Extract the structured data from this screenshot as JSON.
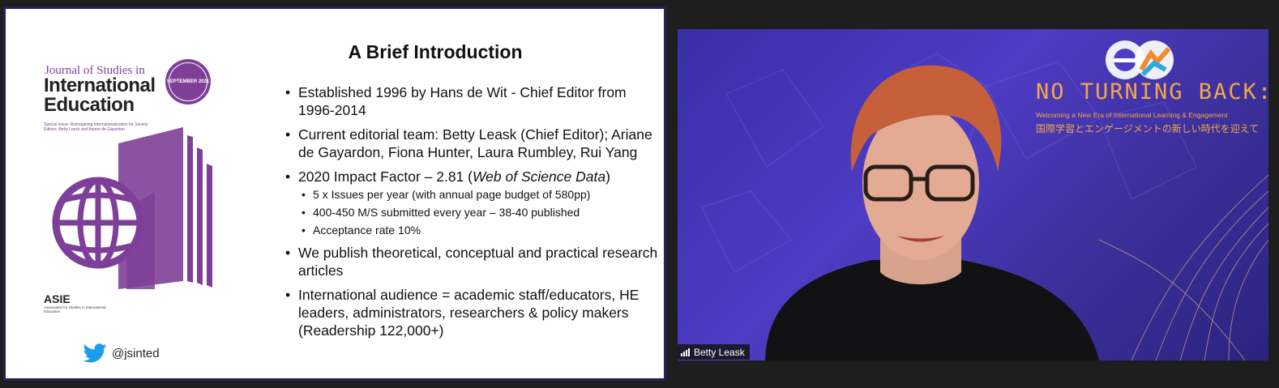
{
  "slide": {
    "title": "A Brief Introduction",
    "cover": {
      "journal_line1": "Journal of Studies in",
      "journal_line2a": "International",
      "journal_line2b": "Education",
      "badge_text": "SEPTEMBER 2021",
      "special_issue": "Special Issue: Reimagining Internationalization for Society Editors: Betty Leask and Ariane de Gayardon",
      "publisher": "ASIE",
      "publisher_sub": "Association for Studies in International Education"
    },
    "twitter_handle": "@jsinted",
    "bullets": [
      {
        "text": "Established 1996 by Hans de Wit - Chief Editor from 1996-2014"
      },
      {
        "text": "Current editorial team: Betty Leask (Chief Editor); Ariane de Gayardon, Fiona Hunter, Laura Rumbley, Rui Yang"
      },
      {
        "text_prefix": "2020 Impact Factor – 2.81 (",
        "text_italic": "Web of Science Data",
        "text_suffix": ")",
        "sub": [
          "5 x Issues per year (with annual page budget of 580pp)",
          "400-450 M/S submitted every year – 38-40 published",
          "Acceptance rate 10%"
        ]
      },
      {
        "text": "We publish theoretical, conceptual and practical research articles"
      },
      {
        "text": "International audience = academic staff/educators, HE leaders, administrators, researchers & policy makers (Readership 122,000+)"
      }
    ]
  },
  "video": {
    "banner_title": "NO TURNING BACK:",
    "banner_subtitle": "Welcoming a New Era of International Learning & Engagement",
    "banner_japanese": "国際学習とエンゲージメントの新しい時代を迎えて",
    "participant_name": "Betty Leask"
  },
  "colors": {
    "journal_purple": "#7e3f98",
    "banner_orange": "#f0a848",
    "background": "#1e1e1e"
  }
}
